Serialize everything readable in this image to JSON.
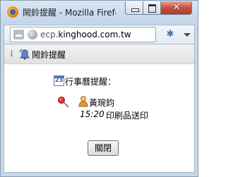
{
  "window": {
    "title": "鬧鈴提醒 - Mozilla Firefox"
  },
  "navbar": {
    "url_prefix": "ecp.",
    "url_domain": "kinghood.com.tw"
  },
  "header": {
    "title": "鬧鈴提醒"
  },
  "reminder": {
    "calendar_icon_text": "23",
    "section_title": "行事曆提醒：",
    "person_name": "黃琬鈞",
    "event_time": "15:20",
    "event_title": "印刷品送印"
  },
  "actions": {
    "close_label": "關閉"
  },
  "colors": {
    "window_frame": "#c8d8ea",
    "close_button_red": "#c7503c",
    "header_strip": "#e8e8e8"
  }
}
